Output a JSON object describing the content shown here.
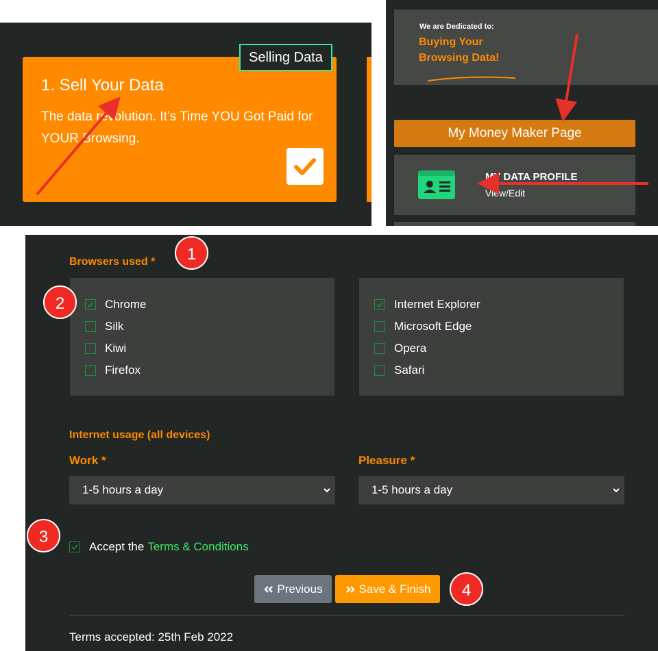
{
  "panel_a": {
    "step_title": "1. Sell Your Data",
    "step_description": "The data revolution. It’s Time YOU Got Paid for YOUR Browsing.",
    "badge_label": "Selling Data"
  },
  "panel_b": {
    "dedicated_small": "We are Dedicated to:",
    "dedicated_line1": "Buying Your",
    "dedicated_line2": "Browsing Data!",
    "money_button_label": "My Money Maker Page",
    "profile_title": "MY DATA PROFILE",
    "profile_subtitle": "View/Edit"
  },
  "form": {
    "browsers_label": "Browsers used",
    "required_mark": "*",
    "browsers_left": [
      {
        "label": "Chrome",
        "checked": true
      },
      {
        "label": "Silk",
        "checked": false
      },
      {
        "label": "Kiwi",
        "checked": false
      },
      {
        "label": "Firefox",
        "checked": false
      }
    ],
    "browsers_right": [
      {
        "label": "Internet Explorer",
        "checked": true
      },
      {
        "label": "Microsoft Edge",
        "checked": false
      },
      {
        "label": "Opera",
        "checked": false
      },
      {
        "label": "Safari",
        "checked": false
      }
    ],
    "usage_label": "Internet usage (all devices)",
    "work_label": "Work",
    "pleasure_label": "Pleasure",
    "work_value": "1-5 hours a day",
    "pleasure_value": "1-5 hours a day",
    "accept_text": "Accept the",
    "terms_link": "Terms & Conditions",
    "terms_checked": true,
    "previous_label": "Previous",
    "save_label": "Save & Finish",
    "terms_accepted_text": "Terms accepted: 25th Feb 2022"
  },
  "markers": [
    "1",
    "2",
    "3",
    "4"
  ],
  "colors": {
    "accent_orange": "#ff8a00",
    "dark_background": "#222624",
    "check_green": "#1e8f3f",
    "link_green": "#3ee66a",
    "marker_red": "#ef2a24",
    "arrow_red": "#e8302a"
  }
}
